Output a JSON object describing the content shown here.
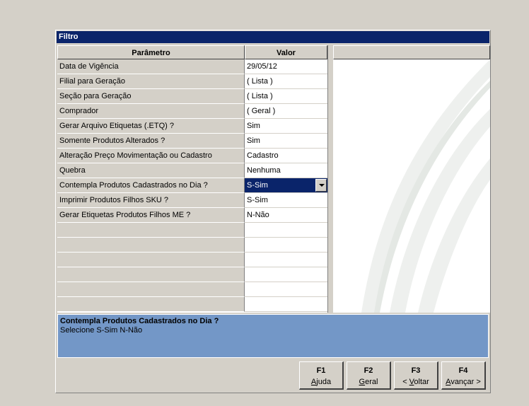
{
  "window": {
    "title": "Filtro"
  },
  "grid": {
    "header_param": "Parâmetro",
    "header_valor": "Valor",
    "rows": [
      {
        "param": "Data de Vigência",
        "valor": "29/05/12"
      },
      {
        "param": "Filial para Geração",
        "valor": "( Lista )"
      },
      {
        "param": "Seção para Geração",
        "valor": "( Lista )"
      },
      {
        "param": "Comprador",
        "valor": "( Geral )"
      },
      {
        "param": "Gerar Arquivo Etiquetas (.ETQ) ?",
        "valor": "Sim"
      },
      {
        "param": "Somente Produtos Alterados ?",
        "valor": "Sim"
      },
      {
        "param": "Alteração Preço Movimentação ou Cadastro",
        "valor": "Cadastro"
      },
      {
        "param": "Quebra",
        "valor": "Nenhuma"
      },
      {
        "param": "Contempla Produtos Cadastrados no Dia ?",
        "valor": "S-Sim"
      },
      {
        "param": "Imprimir Produtos Filhos SKU ?",
        "valor": "S-Sim"
      },
      {
        "param": "Gerar Etiquetas  Produtos Filhos ME ?",
        "valor": "N-Não"
      },
      {
        "param": "",
        "valor": ""
      },
      {
        "param": "",
        "valor": ""
      },
      {
        "param": "",
        "valor": ""
      },
      {
        "param": "",
        "valor": ""
      },
      {
        "param": "",
        "valor": ""
      },
      {
        "param": "",
        "valor": ""
      }
    ],
    "selected_index": 8
  },
  "info": {
    "title": "Contempla Produtos Cadastrados no Dia ?",
    "text": "Selecione S-Sim N-Não"
  },
  "buttons": [
    {
      "key": "F1",
      "pre": "",
      "ul": "A",
      "post": "juda"
    },
    {
      "key": "F2",
      "pre": "",
      "ul": "G",
      "post": "eral"
    },
    {
      "key": "F3",
      "pre": "< ",
      "ul": "V",
      "post": "oltar"
    },
    {
      "key": "F4",
      "pre": "",
      "ul": "A",
      "post": "vançar >"
    }
  ],
  "colors": {
    "title_bar": "#0a246a",
    "info_panel": "#7397c7",
    "face": "#d4d0c8"
  }
}
